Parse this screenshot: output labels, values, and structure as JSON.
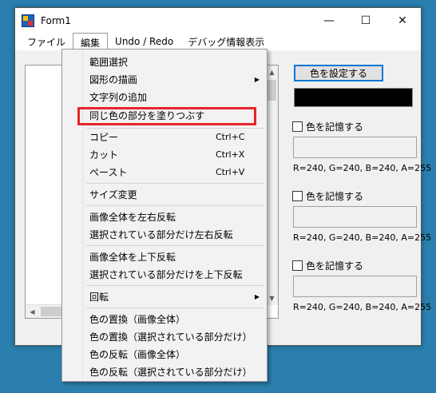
{
  "window": {
    "title": "Form1",
    "controls": {
      "minimize": "—",
      "maximize": "☐",
      "close": "✕"
    }
  },
  "menubar": {
    "items": [
      {
        "label": "ファイル"
      },
      {
        "label": "編集"
      },
      {
        "label": "Undo / Redo"
      },
      {
        "label": "デバッグ情報表示"
      }
    ]
  },
  "edit_menu": {
    "items": [
      {
        "label": "範囲選択",
        "shortcut": ""
      },
      {
        "label": "図形の描画",
        "shortcut": "",
        "submenu": true
      },
      {
        "label": "文字列の追加",
        "shortcut": ""
      },
      {
        "label": "同じ色の部分を塗りつぶす",
        "shortcut": ""
      },
      {
        "label": "コピー",
        "shortcut": "Ctrl+C"
      },
      {
        "label": "カット",
        "shortcut": "Ctrl+X"
      },
      {
        "label": "ペースト",
        "shortcut": "Ctrl+V"
      },
      {
        "label": "サイズ変更",
        "shortcut": ""
      },
      {
        "label": "画像全体を左右反転",
        "shortcut": ""
      },
      {
        "label": "選択されている部分だけ左右反転",
        "shortcut": ""
      },
      {
        "label": "画像全体を上下反転",
        "shortcut": ""
      },
      {
        "label": "選択されている部分だけを上下反転",
        "shortcut": ""
      },
      {
        "label": "回転",
        "shortcut": "",
        "submenu": true
      },
      {
        "label": "色の置換（画像全体）",
        "shortcut": ""
      },
      {
        "label": "色の置換（選択されている部分だけ）",
        "shortcut": ""
      },
      {
        "label": "色の反転（画像全体）",
        "shortcut": ""
      },
      {
        "label": "色の反転（選択されている部分だけ）",
        "shortcut": ""
      }
    ],
    "submenu_arrow": "▶",
    "highlighted_item": "同じ色の部分を塗りつぶす"
  },
  "right_panel": {
    "set_color_button": "色を設定する",
    "current_color": "#000000",
    "memory_slots": [
      {
        "label": "色を記憶する",
        "rgba": "R=240, G=240, B=240, A=255",
        "swatch": "#f0f0f0"
      },
      {
        "label": "色を記憶する",
        "rgba": "R=240, G=240, B=240, A=255",
        "swatch": "#f0f0f0"
      },
      {
        "label": "色を記憶する",
        "rgba": "R=240, G=240, B=240, A=255",
        "swatch": "#f0f0f0"
      }
    ]
  },
  "scrollbars": {
    "up": "▲",
    "down": "▼",
    "left": "◀",
    "right": "▶"
  },
  "colors": {
    "desktop": "#2a7fae",
    "highlight_border": "#e8232a",
    "focus_border": "#0078d7"
  }
}
